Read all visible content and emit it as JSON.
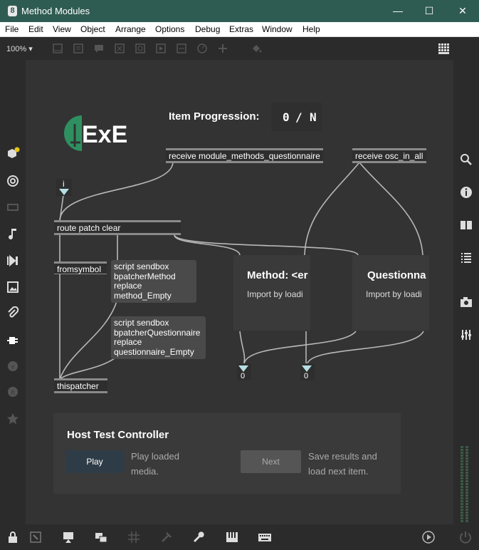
{
  "window": {
    "title": "Method Modules",
    "minimize": "—",
    "maximize": "☐",
    "close": "✕"
  },
  "menu": [
    "File",
    "Edit",
    "View",
    "Object",
    "Arrange",
    "Options",
    "Debug",
    "Extras",
    "Window",
    "Help"
  ],
  "toolbar": {
    "zoom": "100%"
  },
  "logo": {
    "text": "ExE",
    "accent_color": "#2e9060"
  },
  "progress": {
    "label": "Item Progression:",
    "current": "0",
    "separator": "/",
    "total": "N"
  },
  "objects": {
    "receive_questionnaire": "receive module_methods_questionnaire",
    "receive_osc": "receive osc_in_all",
    "inlet_i": "i",
    "route": "route patch clear",
    "fromsymbol": "fromsymbol",
    "thispatcher": "thispatcher"
  },
  "messages": {
    "method_script": [
      "script sendbox",
      "bpatcherMethod",
      "replace",
      "method_Empty"
    ],
    "questionnaire_script": [
      "script sendbox",
      "bpatcherQuestionnaire",
      "replace",
      "questionnaire_Empty"
    ]
  },
  "bpatchers": {
    "method": {
      "title": "Method: <er",
      "subtitle": "Import by loadi"
    },
    "questionnaire": {
      "title": "Questionna",
      "subtitle": "Import by loadi"
    }
  },
  "outlet_buttons": {
    "left_value": "0",
    "right_value": "0"
  },
  "host": {
    "title": "Host Test Controller",
    "play_label": "Play",
    "play_desc": [
      "Play loaded",
      "media."
    ],
    "next_label": "Next",
    "next_desc": [
      "Save results and",
      "load next item."
    ]
  },
  "colors": {
    "titlebar": "#2f5c52",
    "canvas": "#333333",
    "cable": "#b8b8b8",
    "play_button": "#2e3c48"
  }
}
